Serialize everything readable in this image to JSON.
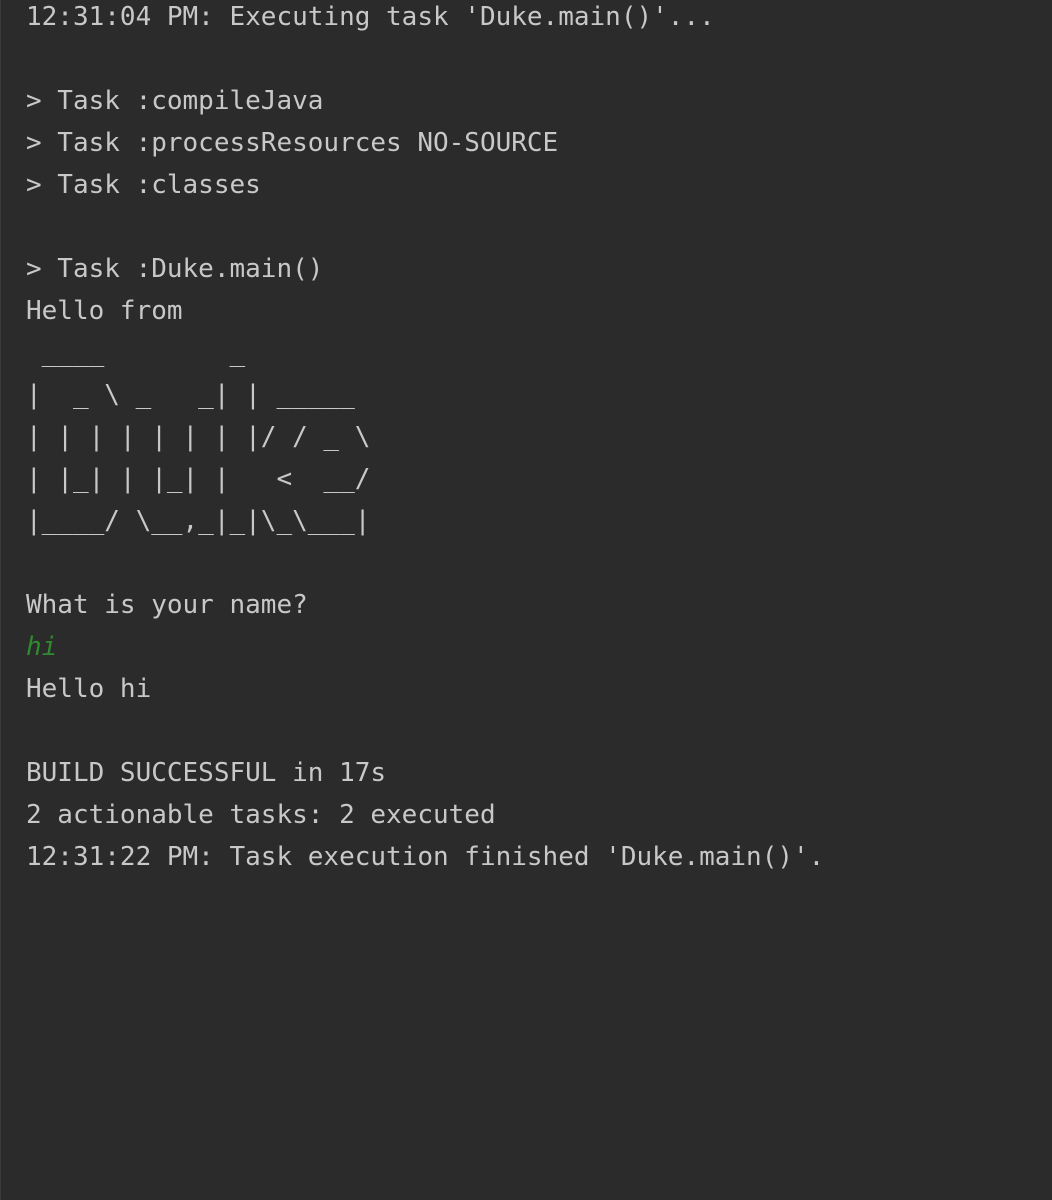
{
  "console": {
    "lines": [
      {
        "text": "12:31:04 PM: Executing task 'Duke.main()'...",
        "kind": "output"
      },
      {
        "text": "",
        "kind": "blank"
      },
      {
        "text": "> Task :compileJava",
        "kind": "output"
      },
      {
        "text": "> Task :processResources NO-SOURCE",
        "kind": "output"
      },
      {
        "text": "> Task :classes",
        "kind": "output"
      },
      {
        "text": "",
        "kind": "blank"
      },
      {
        "text": "> Task :Duke.main()",
        "kind": "output"
      },
      {
        "text": "Hello from",
        "kind": "output"
      },
      {
        "text": " ____        _",
        "kind": "output"
      },
      {
        "text": "|  _ \\ _   _| | _____",
        "kind": "output"
      },
      {
        "text": "| | | | | | | |/ / _ \\",
        "kind": "output"
      },
      {
        "text": "| |_| | |_| |   <  __/",
        "kind": "output"
      },
      {
        "text": "|____/ \\__,_|_|\\_\\___|",
        "kind": "output"
      },
      {
        "text": "",
        "kind": "blank"
      },
      {
        "text": "What is your name?",
        "kind": "output"
      },
      {
        "text": "hi",
        "kind": "input"
      },
      {
        "text": "Hello hi",
        "kind": "output"
      },
      {
        "text": "",
        "kind": "blank"
      },
      {
        "text": "BUILD SUCCESSFUL in 17s",
        "kind": "output"
      },
      {
        "text": "2 actionable tasks: 2 executed",
        "kind": "output"
      },
      {
        "text": "12:31:22 PM: Task execution finished 'Duke.main()'.",
        "kind": "output"
      }
    ]
  },
  "colors": {
    "background": "#2b2b2b",
    "output_text": "#c8c8c8",
    "user_input_text": "#2f8a2f"
  }
}
